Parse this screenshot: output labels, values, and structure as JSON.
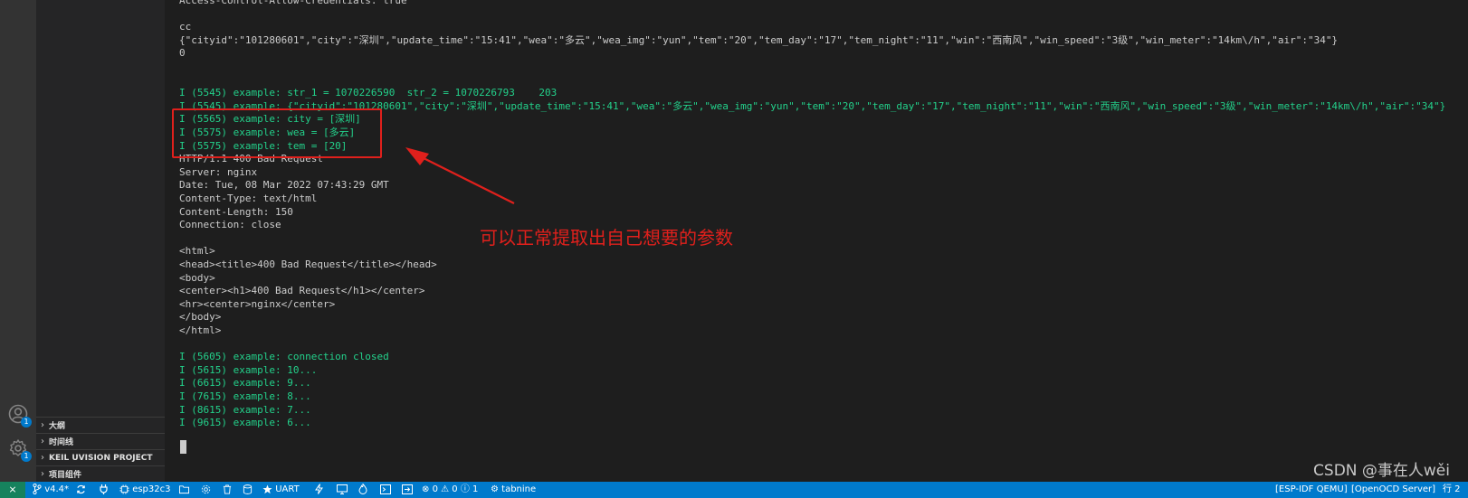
{
  "sidebar": {
    "sections": [
      {
        "label": "大纲"
      },
      {
        "label": "时间线"
      },
      {
        "label": "KEIL UVISION PROJECT"
      },
      {
        "label": "项目组件"
      }
    ],
    "accounts_badge": "1",
    "manage_badge": "1"
  },
  "terminal": {
    "lines": [
      {
        "text": "Access-Control-Allow-Credentials: true",
        "color": "white"
      },
      {
        "text": "",
        "color": "white"
      },
      {
        "text": "cc",
        "color": "white"
      },
      {
        "text": "{\"cityid\":\"101280601\",\"city\":\"深圳\",\"update_time\":\"15:41\",\"wea\":\"多云\",\"wea_img\":\"yun\",\"tem\":\"20\",\"tem_day\":\"17\",\"tem_night\":\"11\",\"win\":\"西南风\",\"win_speed\":\"3级\",\"win_meter\":\"14km\\/h\",\"air\":\"34\"}",
        "color": "white"
      },
      {
        "text": "0",
        "color": "white"
      },
      {
        "text": "",
        "color": "white"
      },
      {
        "text": "",
        "color": "white"
      },
      {
        "text": "I (5545) example: str_1 = 1070226590  str_2 = 1070226793    203",
        "color": "green"
      },
      {
        "text": "I (5545) example: {\"cityid\":\"101280601\",\"city\":\"深圳\",\"update_time\":\"15:41\",\"wea\":\"多云\",\"wea_img\":\"yun\",\"tem\":\"20\",\"tem_day\":\"17\",\"tem_night\":\"11\",\"win\":\"西南风\",\"win_speed\":\"3级\",\"win_meter\":\"14km\\/h\",\"air\":\"34\"}",
        "color": "green"
      },
      {
        "text": "I (5565) example: city = [深圳]",
        "color": "green"
      },
      {
        "text": "I (5575) example: wea = [多云]",
        "color": "green"
      },
      {
        "text": "I (5575) example: tem = [20]",
        "color": "green"
      },
      {
        "text": "HTTP/1.1 400 Bad Request",
        "color": "white"
      },
      {
        "text": "Server: nginx",
        "color": "white"
      },
      {
        "text": "Date: Tue, 08 Mar 2022 07:43:29 GMT",
        "color": "white"
      },
      {
        "text": "Content-Type: text/html",
        "color": "white"
      },
      {
        "text": "Content-Length: 150",
        "color": "white"
      },
      {
        "text": "Connection: close",
        "color": "white"
      },
      {
        "text": "",
        "color": "white"
      },
      {
        "text": "<html>",
        "color": "white"
      },
      {
        "text": "<head><title>400 Bad Request</title></head>",
        "color": "white"
      },
      {
        "text": "<body>",
        "color": "white"
      },
      {
        "text": "<center><h1>400 Bad Request</h1></center>",
        "color": "white"
      },
      {
        "text": "<hr><center>nginx</center>",
        "color": "white"
      },
      {
        "text": "</body>",
        "color": "white"
      },
      {
        "text": "</html>",
        "color": "white"
      },
      {
        "text": "",
        "color": "white"
      },
      {
        "text": "I (5605) example: connection closed",
        "color": "green"
      },
      {
        "text": "I (5615) example: 10...",
        "color": "green"
      },
      {
        "text": "I (6615) example: 9...",
        "color": "green"
      },
      {
        "text": "I (7615) example: 8...",
        "color": "green"
      },
      {
        "text": "I (8615) example: 7...",
        "color": "green"
      },
      {
        "text": "I (9615) example: 6...",
        "color": "green"
      }
    ]
  },
  "annotation": {
    "text": "可以正常提取出自己想要的参数"
  },
  "watermark": {
    "text": "CSDN @事在人wěi"
  },
  "statusbar": {
    "remote": "⨯",
    "branch": "v4.4*",
    "target": "esp32c3",
    "uart": "UART",
    "problems": {
      "errors": "0",
      "warnings": "0",
      "info": "1"
    },
    "tabnine": "tabnine",
    "qemu": "[ESP-IDF QEMU]",
    "openocd": "[OpenOCD Server]",
    "line": "行 2"
  },
  "colors": {
    "terminal_white": "#cccccc",
    "terminal_green": "#23d18b",
    "statusbar_bg": "#007acc",
    "annotation_red": "#e0201c"
  }
}
